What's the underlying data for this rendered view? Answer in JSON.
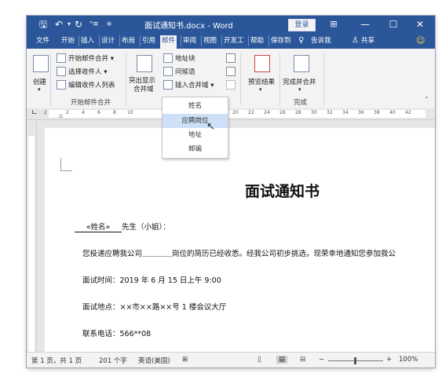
{
  "window": {
    "title": "面试通知书.docx  -  Word",
    "login_label": "登录",
    "save_icon": "save-icon",
    "undo_icon": "undo-icon",
    "redo_icon": "redo-icon"
  },
  "tabs": [
    "文件",
    "开始",
    "插入",
    "设计",
    "布局",
    "引用",
    "邮件",
    "审阅",
    "视图",
    "开发工",
    "帮助",
    "保存到",
    "告诉我",
    "共享"
  ],
  "ribbon": {
    "create_label": "创建",
    "start_merge": "开始邮件合并",
    "select_recipients": "选择收件人",
    "edit_recipients": "编辑收件人列表",
    "group_start": "开始邮件合并",
    "highlight_fields": "突出显示合并域",
    "highlight_l1": "突出显示",
    "highlight_l2": "合并域",
    "address_block": "地址块",
    "greeting": "问候语",
    "insert_field": "插入合并域",
    "preview": "预览结果",
    "finish": "完成并合并",
    "group_finish": "完成"
  },
  "dropdown": {
    "items": [
      "姓名",
      "应聘岗位",
      "地址",
      "邮编"
    ],
    "hover_index": 1
  },
  "ruler": [
    "2",
    "2",
    "4",
    "6",
    "8",
    "10",
    "20",
    "22",
    "24",
    "26",
    "28",
    "30",
    "32",
    "34",
    "36",
    "38",
    "40",
    "42"
  ],
  "document": {
    "title": "面试通知书",
    "line_name_field": "«姓名»",
    "line_name_rest": "先生（小姐）：",
    "line_body": "您投递应聘我公司＿＿＿＿岗位的简历已经收悉。经我公司初步挑选，现荣幸地通知您参加我公",
    "line_time": "面试时间：2019 年 6 月 15 日上午 9:00",
    "line_place": "面试地点：××市××路××号 1 楼会议大厅",
    "line_phone": "联系电话：566**08"
  },
  "status": {
    "pages": "第 1 页，共 1 页",
    "words": "201 个字",
    "language": "英语(美国)",
    "zoom": "100%"
  }
}
